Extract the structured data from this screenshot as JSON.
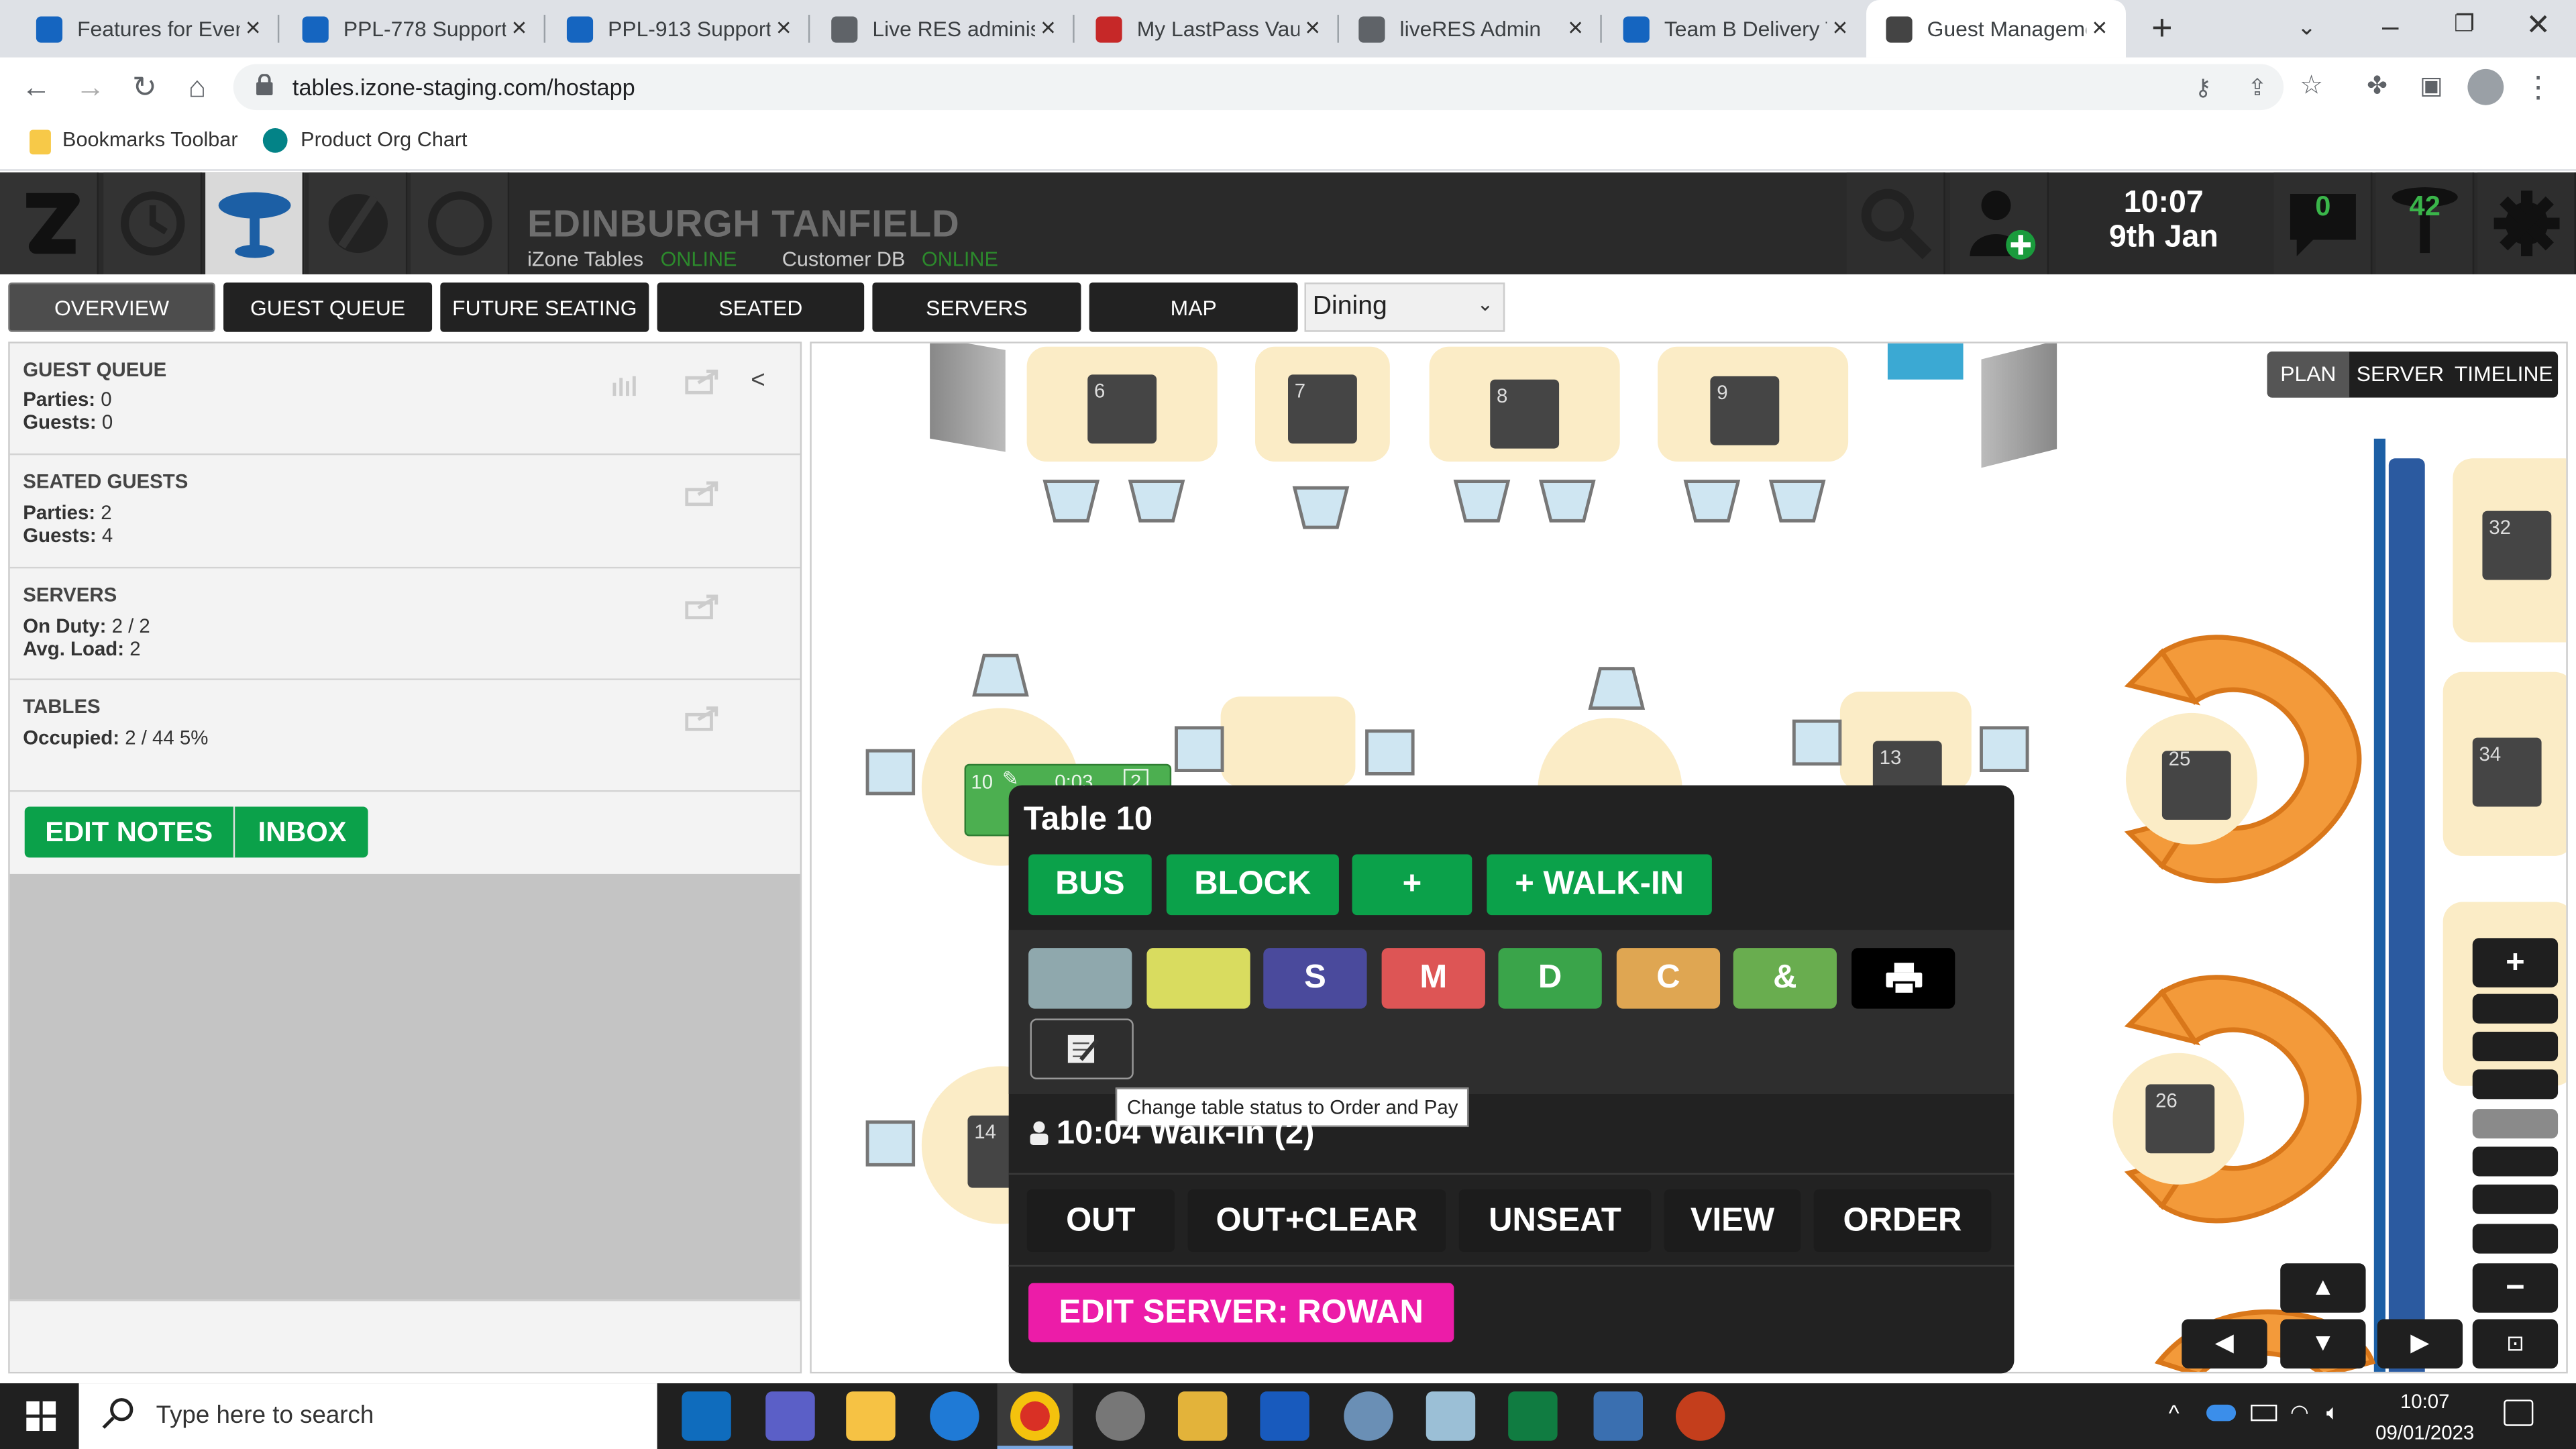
{
  "browser": {
    "tabs": [
      {
        "title": "Features for Event",
        "fav": "#1565c0"
      },
      {
        "title": "PPL-778 Support",
        "fav": "#1565c0"
      },
      {
        "title": "PPL-913 Support",
        "fav": "#1565c0"
      },
      {
        "title": "Live RES administ",
        "fav": "#5f6368"
      },
      {
        "title": "My LastPass Vault",
        "fav": "#c62828"
      },
      {
        "title": "liveRES Admin",
        "fav": "#5f6368"
      },
      {
        "title": "Team B Delivery T",
        "fav": "#1565c0"
      },
      {
        "title": "Guest Manageme",
        "fav": "#444444"
      }
    ],
    "new_tab": "+",
    "url": "tables.izone-staging.com/hostapp",
    "bookmarks": [
      "Bookmarks Toolbar",
      "Product Org Chart"
    ]
  },
  "header": {
    "venue": "EDINBURGH TANFIELD",
    "status1_label": "iZone Tables",
    "status1_value": "ONLINE",
    "status2_label": "Customer DB",
    "status2_value": "ONLINE",
    "time": "10:07",
    "date": "9th Jan",
    "messages_count": "0",
    "tables_count": "42"
  },
  "nav": {
    "items": [
      "OVERVIEW",
      "GUEST QUEUE",
      "FUTURE SEATING",
      "SEATED",
      "SERVERS",
      "MAP"
    ],
    "area_select": "Dining"
  },
  "left": {
    "guest_queue": {
      "title": "GUEST QUEUE",
      "parties_label": "Parties:",
      "parties": "0",
      "guests_label": "Guests:",
      "guests": "0",
      "collapse": "<"
    },
    "seated": {
      "title": "SEATED GUESTS",
      "parties_label": "Parties:",
      "parties": "2",
      "guests_label": "Guests:",
      "guests": "4"
    },
    "servers": {
      "title": "SERVERS",
      "on_duty_label": "On Duty:",
      "on_duty": "2 / 2",
      "load_label": "Avg. Load:",
      "load": "2"
    },
    "tables": {
      "title": "TABLES",
      "occupied_label": "Occupied:",
      "occupied": "2 / 44 5%"
    },
    "edit_notes": "EDIT NOTES",
    "inbox": "INBOX"
  },
  "map": {
    "view_tabs": [
      "PLAN",
      "SERVER",
      "TIMELINE"
    ],
    "tables": [
      "6",
      "7",
      "8",
      "9",
      "32",
      "13",
      "25",
      "34",
      "26",
      "10",
      "14"
    ],
    "table10_badge": {
      "num": "10",
      "time": "0:03",
      "guests": "2"
    },
    "zoom_in": "+",
    "zoom_out": "−"
  },
  "popup": {
    "title": "Table 10",
    "actions": [
      "BUS",
      "BLOCK",
      "+",
      "+ WALK-IN"
    ],
    "status_swatches": [
      {
        "label": "",
        "color": "#8fa8ad"
      },
      {
        "label": "",
        "color": "#d9dc5f"
      },
      {
        "label": "S",
        "color": "#4a4a9c"
      },
      {
        "label": "M",
        "color": "#dd5555"
      },
      {
        "label": "D",
        "color": "#3aa44a"
      },
      {
        "label": "C",
        "color": "#dfa652"
      },
      {
        "label": "&",
        "color": "#69ad4f"
      }
    ],
    "tooltip": "Change table status to Order and Pay",
    "booking": "10:04 Walk-in (2)",
    "bottom_actions": [
      "OUT",
      "OUT+CLEAR",
      "UNSEAT",
      "VIEW",
      "ORDER"
    ],
    "edit_server": "EDIT SERVER: ROWAN"
  },
  "taskbar": {
    "search_placeholder": "Type here to search",
    "time": "10:07",
    "date": "09/01/2023"
  }
}
